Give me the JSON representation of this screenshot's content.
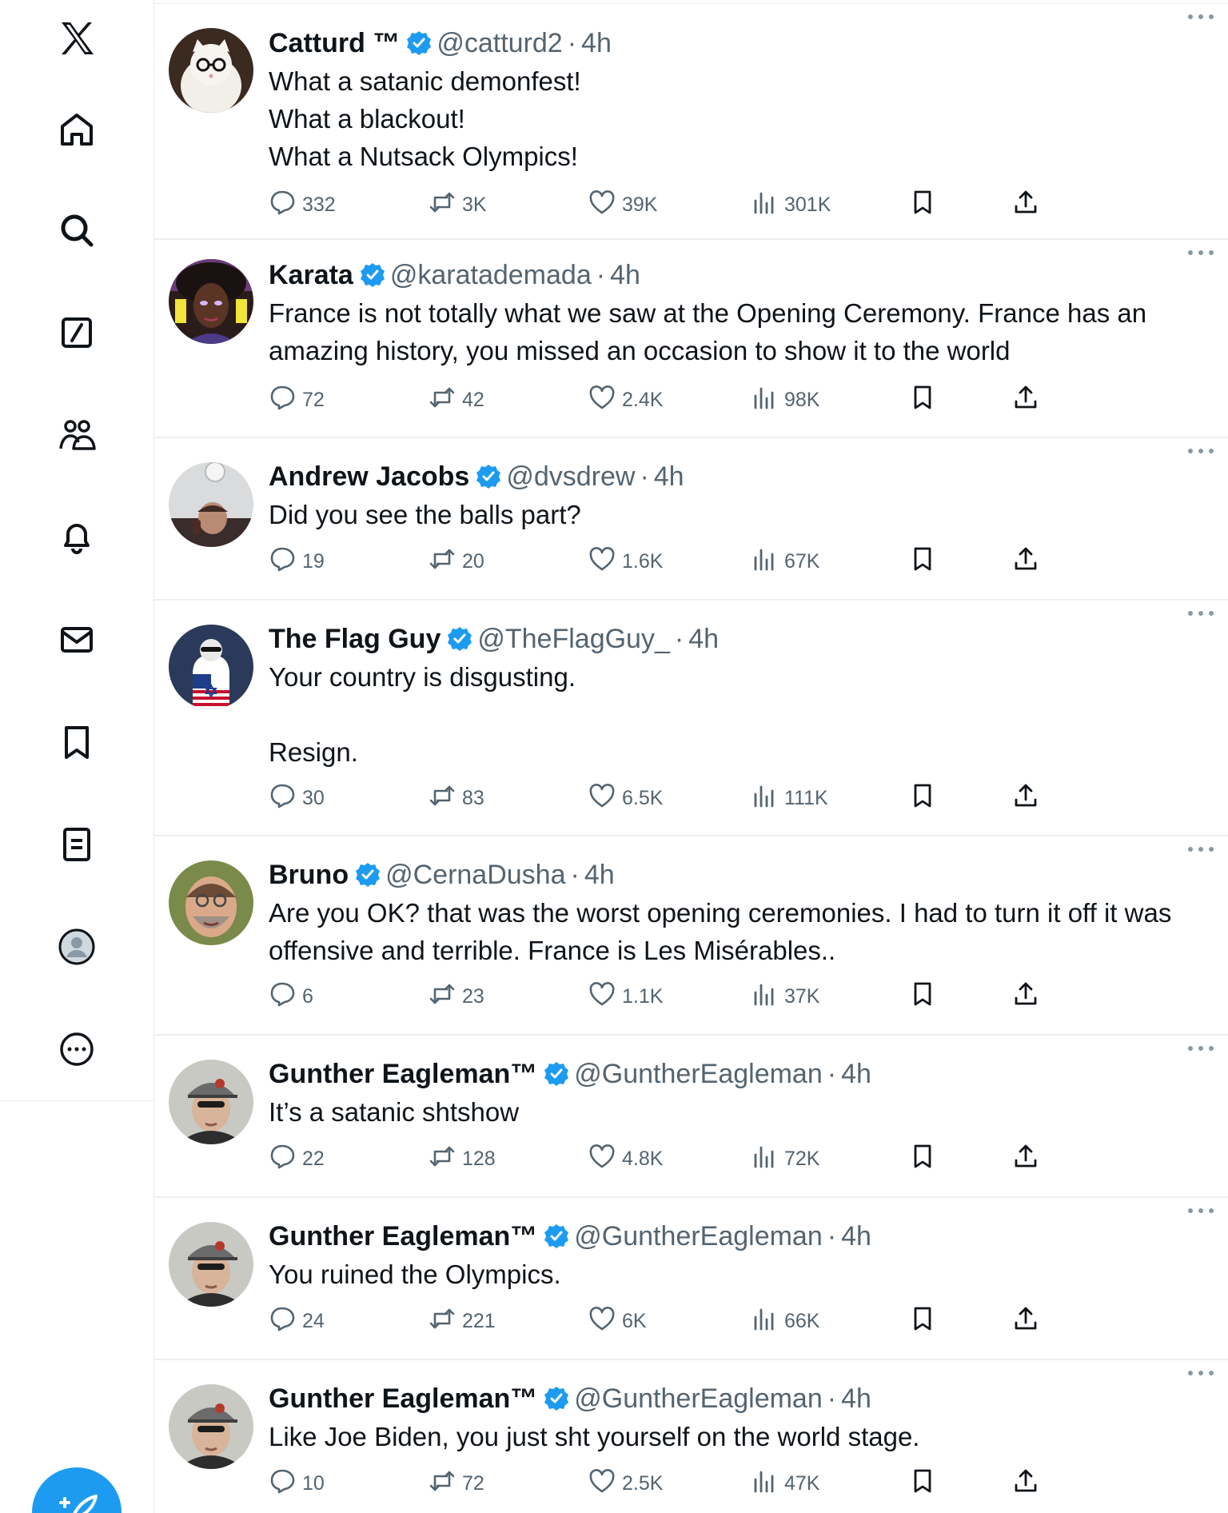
{
  "nav": {
    "items": [
      {
        "name": "x-logo-icon"
      },
      {
        "name": "home-icon"
      },
      {
        "name": "search-icon"
      },
      {
        "name": "grok-icon"
      },
      {
        "name": "communities-icon"
      },
      {
        "name": "notifications-icon"
      },
      {
        "name": "messages-icon"
      },
      {
        "name": "bookmarks-icon"
      },
      {
        "name": "lists-icon"
      },
      {
        "name": "profile-icon"
      },
      {
        "name": "more-icon"
      }
    ],
    "compose": {
      "name": "compose-post-icon"
    }
  },
  "colors": {
    "accent": "#1d9bf0",
    "text": "#0f1419",
    "secondary": "#536471",
    "border": "#e6e9ec"
  },
  "tweets": [
    {
      "name": "Catturd ™",
      "handle": "@catturd2",
      "sep": "·",
      "time": "4h",
      "lines": [
        "What a satanic demonfest!",
        "What a blackout!",
        "What a Nutsack Olympics!"
      ],
      "replies": "332",
      "reposts": "3K",
      "likes": "39K",
      "views": "301K"
    },
    {
      "name": "Karata",
      "handle": "@karatademada",
      "sep": "·",
      "time": "4h",
      "lines": [
        "France is not totally what we saw at the Opening Ceremony. France has an",
        "amazing history, you missed an occasion to show it to the world"
      ],
      "replies": "72",
      "reposts": "42",
      "likes": "2.4K",
      "views": "98K"
    },
    {
      "name": "Andrew Jacobs",
      "handle": "@dvsdrew",
      "sep": "·",
      "time": "4h",
      "lines": [
        "Did you see the balls part?"
      ],
      "replies": "19",
      "reposts": "20",
      "likes": "1.6K",
      "views": "67K"
    },
    {
      "name": "The Flag Guy",
      "handle": "@TheFlagGuy_",
      "sep": "·",
      "time": "4h",
      "lines": [
        "Your country is disgusting.",
        "",
        "Resign."
      ],
      "replies": "30",
      "reposts": "83",
      "likes": "6.5K",
      "views": "111K"
    },
    {
      "name": "Bruno",
      "handle": "@CernaDusha",
      "sep": "·",
      "time": "4h",
      "lines": [
        "Are you OK? that was the worst opening ceremonies. I had to turn it off it was",
        "offensive and terrible. France is Les Misérables.."
      ],
      "replies": "6",
      "reposts": "23",
      "likes": "1.1K",
      "views": "37K"
    },
    {
      "name": "Gunther Eagleman™",
      "handle": "@GuntherEagleman",
      "sep": "·",
      "time": "4h",
      "lines": [
        "It’s a satanic shtshow"
      ],
      "replies": "22",
      "reposts": "128",
      "likes": "4.8K",
      "views": "72K"
    },
    {
      "name": "Gunther Eagleman™",
      "handle": "@GuntherEagleman",
      "sep": "·",
      "time": "4h",
      "lines": [
        "You ruined the Olympics."
      ],
      "replies": "24",
      "reposts": "221",
      "likes": "6K",
      "views": "66K"
    },
    {
      "name": "Gunther Eagleman™",
      "handle": "@GuntherEagleman",
      "sep": "·",
      "time": "4h",
      "lines": [
        "Like Joe Biden,  you just sht yourself on the world stage."
      ],
      "replies": "10",
      "reposts": "72",
      "likes": "2.5K",
      "views": "47K"
    }
  ]
}
